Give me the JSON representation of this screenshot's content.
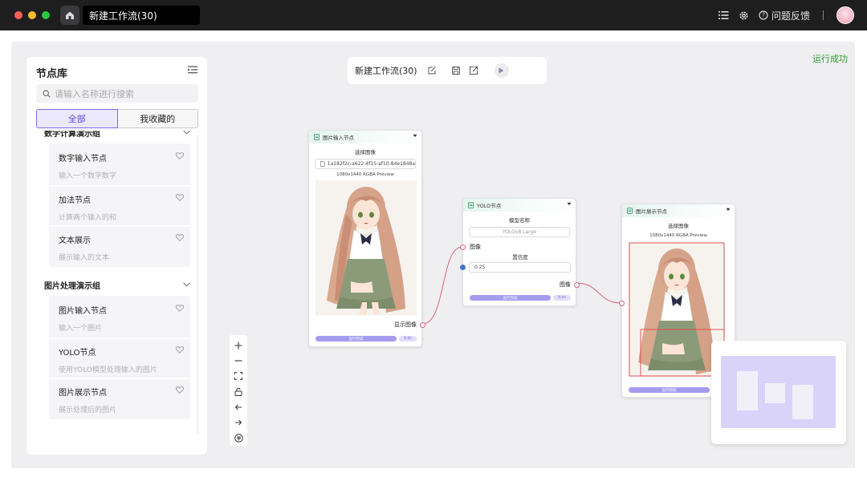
{
  "window": {
    "title_input": "新建工作流(30)",
    "feedback_label": "问题反馈",
    "colors": {
      "close": "#ff5f57",
      "minimize": "#febc2e",
      "maximize": "#28c840"
    }
  },
  "status": {
    "run_result": "运行成功",
    "color": "#2f9e2f"
  },
  "library": {
    "title": "节点库",
    "search_placeholder": "请输入名称进行搜索",
    "tabs": [
      "全部",
      "我收藏的"
    ],
    "groups": [
      {
        "title": "数字计算演示组",
        "items": [
          {
            "name": "数字输入节点",
            "desc": "输入一个数字数字"
          },
          {
            "name": "加法节点",
            "desc": "计算两个输入的和"
          },
          {
            "name": "文本展示",
            "desc": "展示输入的文本"
          }
        ]
      },
      {
        "title": "图片处理演示组",
        "items": [
          {
            "name": "图片输入节点",
            "desc": "输入一个图片"
          },
          {
            "name": "YOLO节点",
            "desc": "使用YOLO模型处理输入的图片"
          },
          {
            "name": "图片展示节点",
            "desc": "展示处理后的图片"
          }
        ]
      }
    ]
  },
  "toolbar": {
    "title": "新建工作流(30)"
  },
  "nodes": {
    "image_input": {
      "title": "图片输入节点",
      "select_label": "选择图像",
      "file_name": "1a182f2c-a622-4f15-af10-84e1848ab",
      "preview_label": "1080x1440 RGBA Preview",
      "output_port": "显示图像",
      "run_label": "运行完成",
      "time_label": "0.0s"
    },
    "yolo": {
      "title": "YOLO节点",
      "model_label": "模型名称",
      "model_value": "YOLOv8 Large",
      "input_port": "图像",
      "confidence_label": "置信度",
      "confidence_value": "0.25",
      "output_port": "图像",
      "run_label": "运行完成",
      "time_label": "0.4s"
    },
    "image_display": {
      "title": "图片展示节点",
      "select_label": "选择图像",
      "preview_label": "1080x1440 RGBA Preview",
      "run_label": "运行完成"
    }
  },
  "accent": {
    "primary": "#7b6cf0",
    "connection": "#d9657a",
    "port": "#d9657a"
  }
}
